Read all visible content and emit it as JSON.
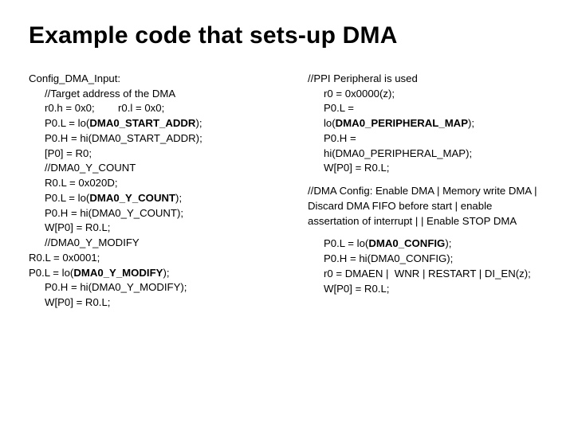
{
  "title": "Example code that sets-up DMA",
  "left": {
    "l1": "Config_DMA_Input:",
    "l2": "//Target address of the DMA",
    "l3": "r0.h = 0x0;        r0.l = 0x0;",
    "l4a": "P0.L = lo(",
    "l4b": "DMA0_START_ADDR",
    "l4c": ");",
    "l5": "P0.H = hi(DMA0_START_ADDR);",
    "l6": "[P0] = R0;",
    "l7": "//DMA0_Y_COUNT",
    "l8": "R0.L = 0x020D;",
    "l9a": "P0.L = lo(",
    "l9b": "DMA0_Y_COUNT",
    "l9c": ");",
    "l10": "P0.H = hi(DMA0_Y_COUNT);",
    "l11": "W[P0] = R0.L;",
    "l12": "//DMA0_Y_MODIFY",
    "l13": "R0.L = 0x0001;",
    "l14a": "P0.L = lo(",
    "l14b": "DMA0_Y_MODIFY",
    "l14c": ");",
    "l15": "P0.H = hi(DMA0_Y_MODIFY);",
    "l16": "W[P0] = R0.L;"
  },
  "right": {
    "r1": "//PPI Peripheral is used",
    "r2": "r0 = 0x0000(z);",
    "r3": "P0.L =",
    "r4a": "lo(",
    "r4b": "DMA0_PERIPHERAL_MAP",
    "r4c": ");",
    "r5": "P0.H =",
    "r6": "hi(DMA0_PERIPHERAL_MAP);",
    "r7": "W[P0] = R0.L;",
    "r8": "//DMA Config: Enable DMA | Memory write DMA | Discard DMA FIFO before start | enable assertation of interrupt | | Enable STOP DMA",
    "r9a": "P0.L = lo(",
    "r9b": "DMA0_CONFIG",
    "r9c": ");",
    "r10": "P0.H = hi(DMA0_CONFIG);",
    "r11": "r0 = DMAEN |  WNR | RESTART | DI_EN(z);",
    "r12": "W[P0] = R0.L;"
  }
}
